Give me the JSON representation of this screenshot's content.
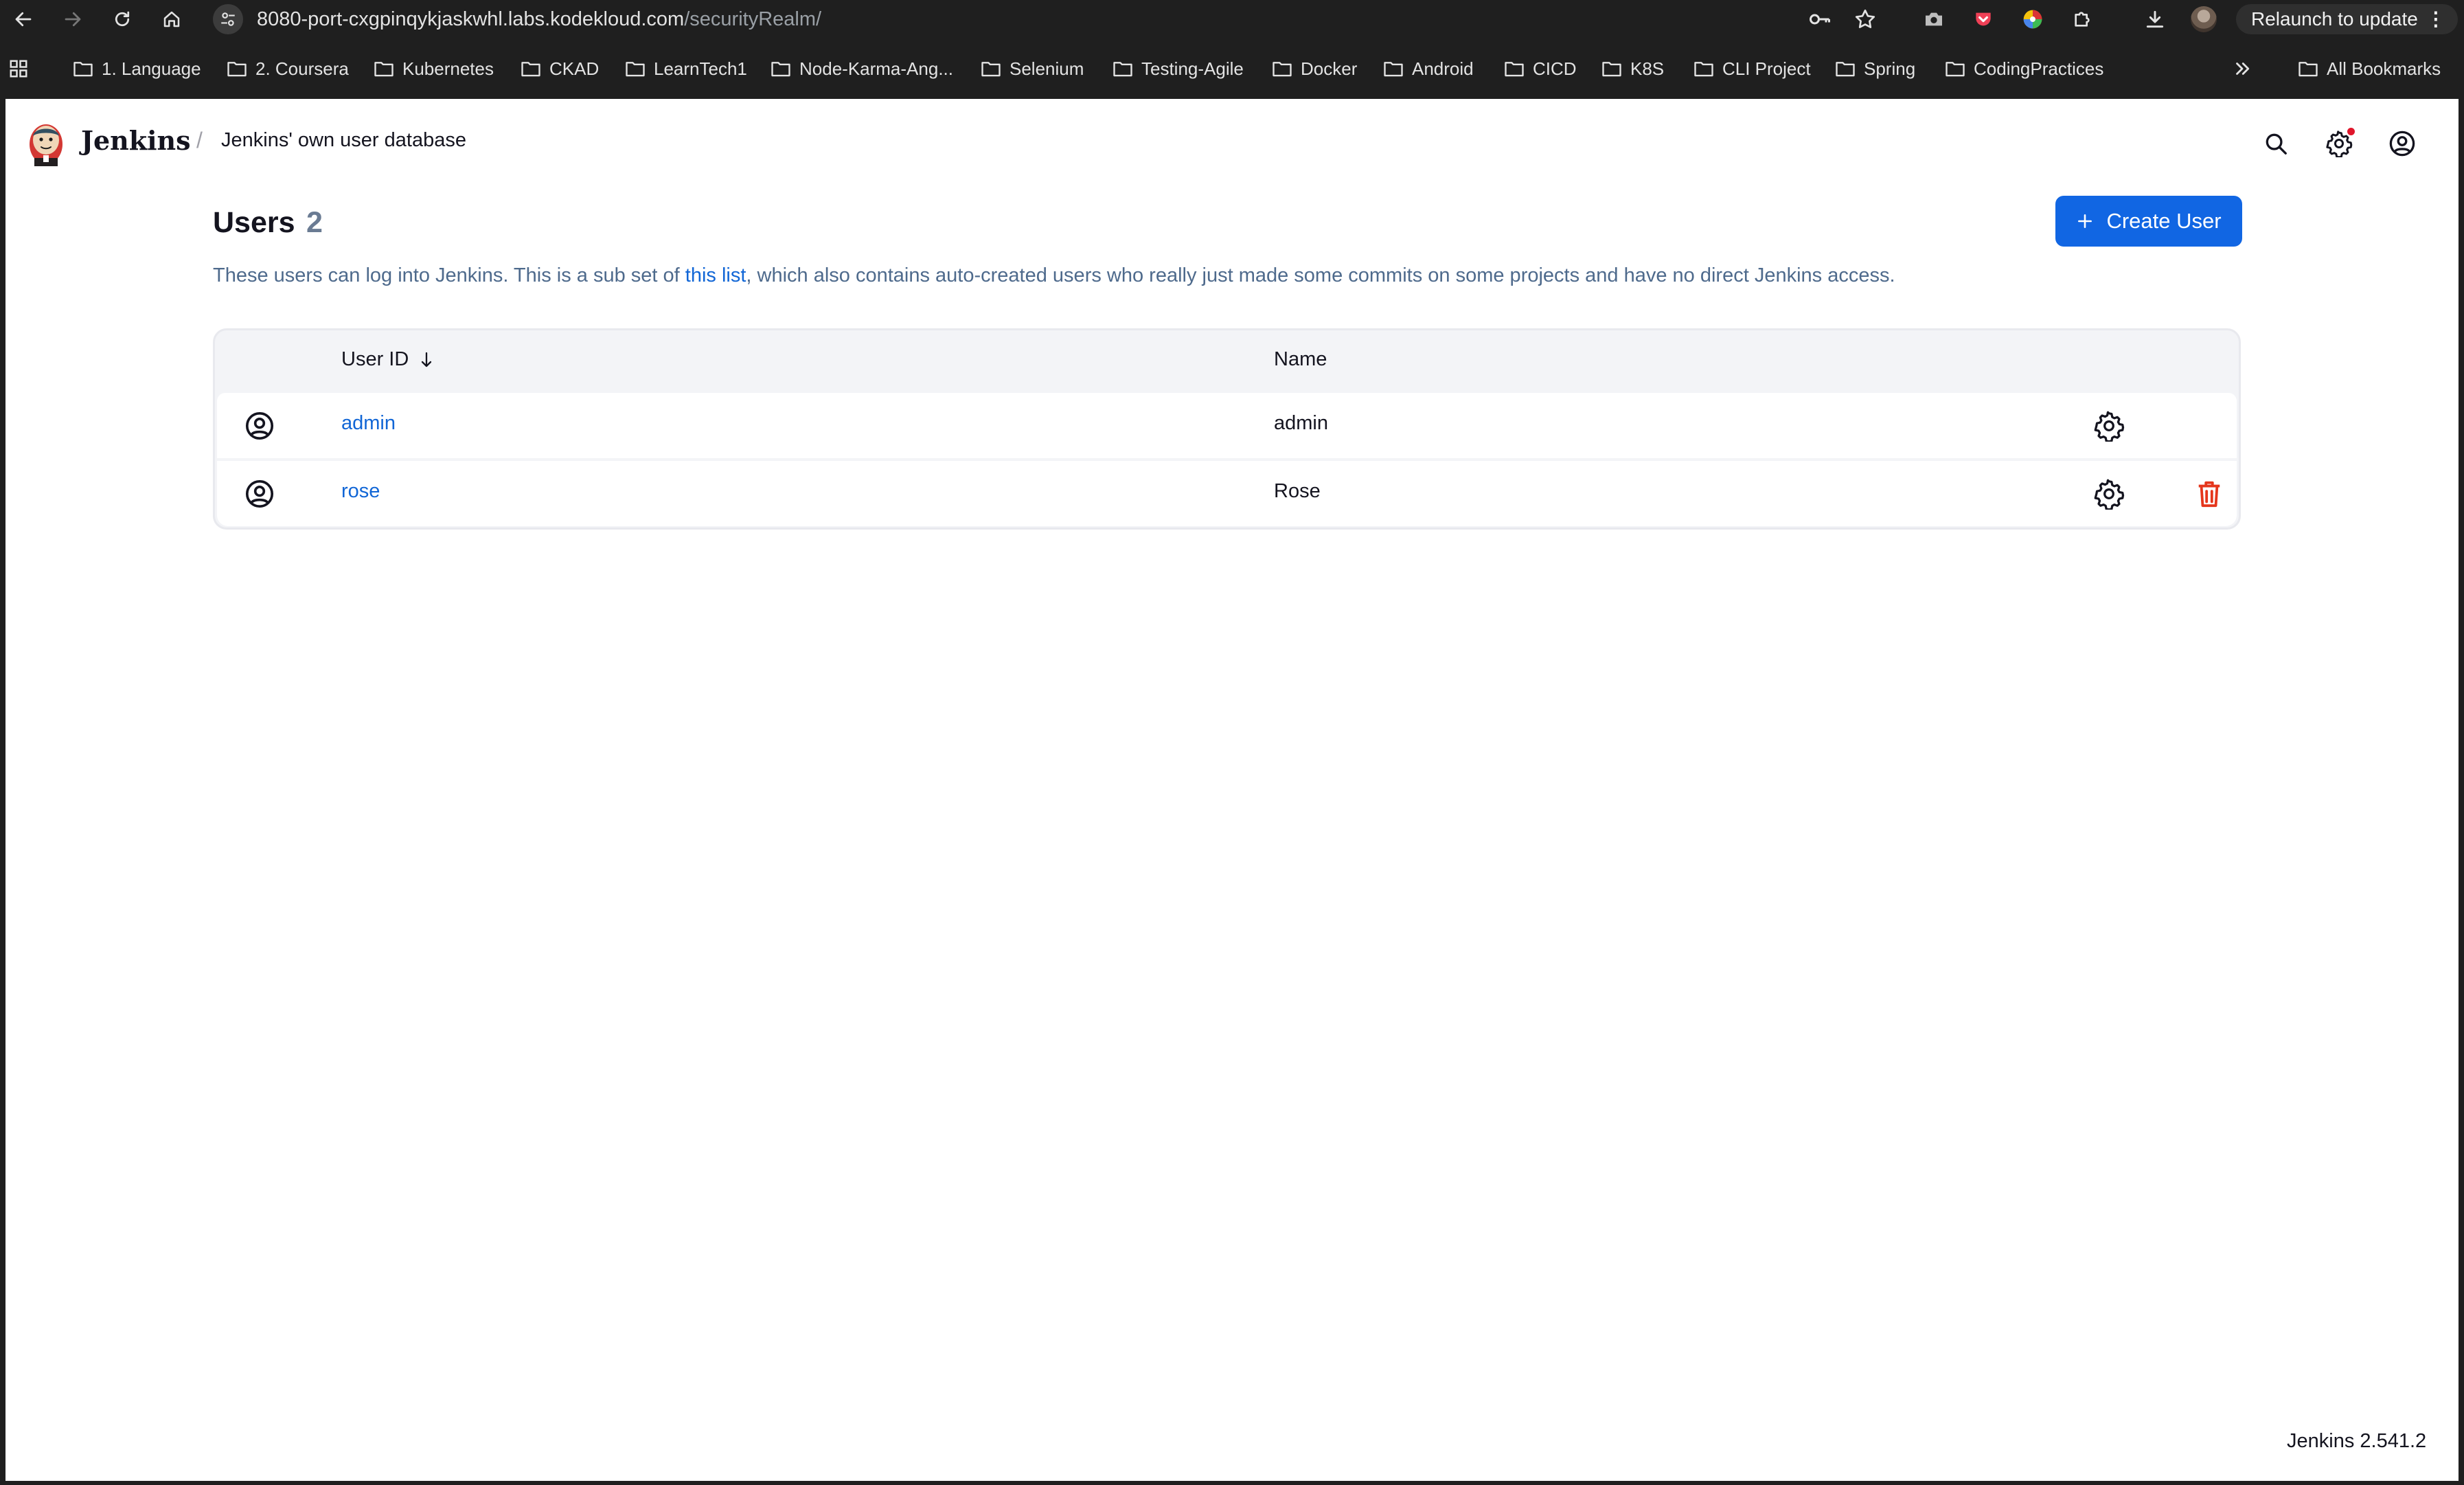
{
  "browser": {
    "url_host": "8080-port-cxgpinqykjaskwhl.labs.kodekloud.com",
    "url_path": "/securityRealm/",
    "relaunch_label": "Relaunch to update",
    "bookmarks": [
      "1. Language",
      "2. Coursera",
      "Kubernetes",
      "CKAD",
      "LearnTech1",
      "Node-Karma-Ang...",
      "Selenium",
      "Testing-Agile",
      "Docker",
      "Android",
      "CICD",
      "K8S",
      "CLI Project",
      "Spring",
      "CodingPractices"
    ],
    "all_bookmarks_label": "All Bookmarks"
  },
  "header": {
    "brand": "Jenkins",
    "breadcrumb": "Jenkins' own user database"
  },
  "page": {
    "title": "Users",
    "count": "2",
    "create_label": "Create User",
    "desc_before": "These users can log into Jenkins. This is a sub set of ",
    "desc_link": "this list",
    "desc_after": ", which also contains auto-created users who really just made some commits on some projects and have no direct Jenkins access."
  },
  "table": {
    "col_user_id": "User ID",
    "col_name": "Name",
    "rows": [
      {
        "user_id": "admin",
        "name": "admin"
      },
      {
        "user_id": "rose",
        "name": "Rose"
      }
    ]
  },
  "footer": {
    "version": "Jenkins 2.541.2"
  },
  "colors": {
    "accent": "#1166e3",
    "link": "#1166d6",
    "danger": "#e5361c",
    "chrome": "#1f1f1f"
  }
}
